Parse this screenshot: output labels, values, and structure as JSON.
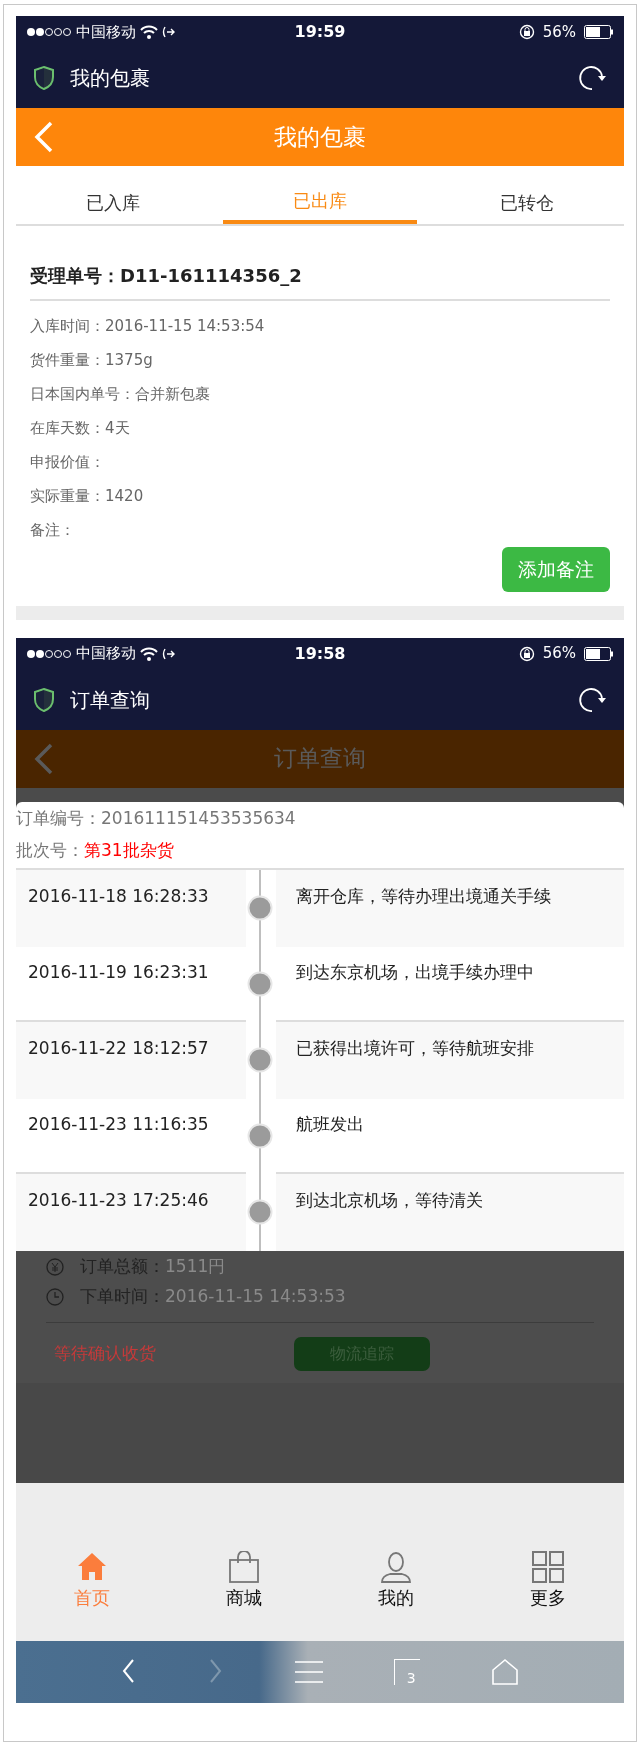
{
  "screens": [
    {
      "status_bar": {
        "carrier": "中国移动",
        "time": "19:59",
        "battery": "56%"
      },
      "app_bar": {
        "title": "我的包裹"
      },
      "page_header": {
        "title": "我的包裹"
      },
      "tabs": [
        {
          "label": "已入库",
          "selected": false
        },
        {
          "label": "已出库",
          "selected": true
        },
        {
          "label": "已转仓",
          "selected": false
        }
      ],
      "parcel": {
        "number_label": "受理单号：",
        "number": "D11-161114356_2",
        "fields": [
          {
            "label": "入库时间：",
            "value": "2016-11-15 14:53:54"
          },
          {
            "label": "货件重量：",
            "value": "1375g"
          },
          {
            "label": "日本国内单号：",
            "value": "合并新包裹"
          },
          {
            "label": "在库天数：",
            "value": "4天"
          },
          {
            "label": "申报价值："
          },
          {
            "label": "实际重量：",
            "value": "1420"
          },
          {
            "label": "备注："
          }
        ],
        "button": "添加备注"
      }
    },
    {
      "status_bar": {
        "carrier": "中国移动",
        "time": "19:58",
        "battery": "56%"
      },
      "app_bar": {
        "title": "订单查询"
      },
      "page_header": {
        "title": "订单查询"
      },
      "tracking_dialog": {
        "order_label": "订单编号：",
        "order_number": "201611151453535634",
        "batch_label": "批次号：",
        "batch": "第31批杂货",
        "events": [
          {
            "time": "2016-11-18 16:28:33",
            "text": "离开仓库，等待办理出境通关手续"
          },
          {
            "time": "2016-11-19 16:23:31",
            "text": "到达东京机场，出境手续办理中"
          },
          {
            "time": "2016-11-22 18:12:57",
            "text": "已获得出境许可，等待航班安排"
          },
          {
            "time": "2016-11-23 11:16:35",
            "text": "航班发出"
          },
          {
            "time": "2016-11-23 17:25:46",
            "text": "到达北京机场，等待清关"
          }
        ]
      },
      "order": {
        "total_label": "订单总额：",
        "total": "1511円",
        "date_label": "下单时间：",
        "date": "2016-11-15 14:53:53",
        "status": "等待确认收货",
        "button": "物流追踪"
      },
      "bottom_nav": [
        {
          "kind": "home",
          "label": "首页",
          "selected": true
        },
        {
          "kind": "shop",
          "label": "商城",
          "selected": false
        },
        {
          "kind": "profile",
          "label": "我的",
          "selected": false
        },
        {
          "kind": "more",
          "label": "更多",
          "selected": false
        }
      ],
      "browser_toolbar": {
        "tab_count": "3"
      }
    }
  ]
}
